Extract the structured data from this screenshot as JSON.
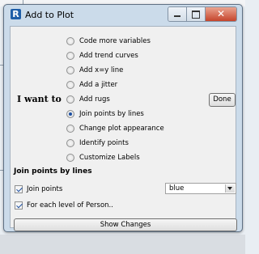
{
  "window": {
    "title": "Add to Plot",
    "app_icon_letter": "R"
  },
  "plot_options": {
    "prompt": "I want to",
    "options": [
      {
        "label": "Code more variables",
        "selected": false
      },
      {
        "label": "Add trend curves",
        "selected": false
      },
      {
        "label": "Add x=y line",
        "selected": false
      },
      {
        "label": "Add a jitter",
        "selected": false
      },
      {
        "label": "Add rugs",
        "selected": false
      },
      {
        "label": "Join points by lines",
        "selected": true
      },
      {
        "label": "Change plot appearance",
        "selected": false
      },
      {
        "label": "Identify points",
        "selected": false
      },
      {
        "label": "Customize Labels",
        "selected": false
      }
    ],
    "done_label": "Done"
  },
  "join_section": {
    "title": "Join points by lines",
    "join_points_label": "Join points",
    "join_points_checked": true,
    "color_value": "blue",
    "per_level_label": "For each level of Person..",
    "per_level_checked": true
  },
  "show_changes_label": "Show Changes",
  "background": {
    "bottom_label": "..."
  }
}
